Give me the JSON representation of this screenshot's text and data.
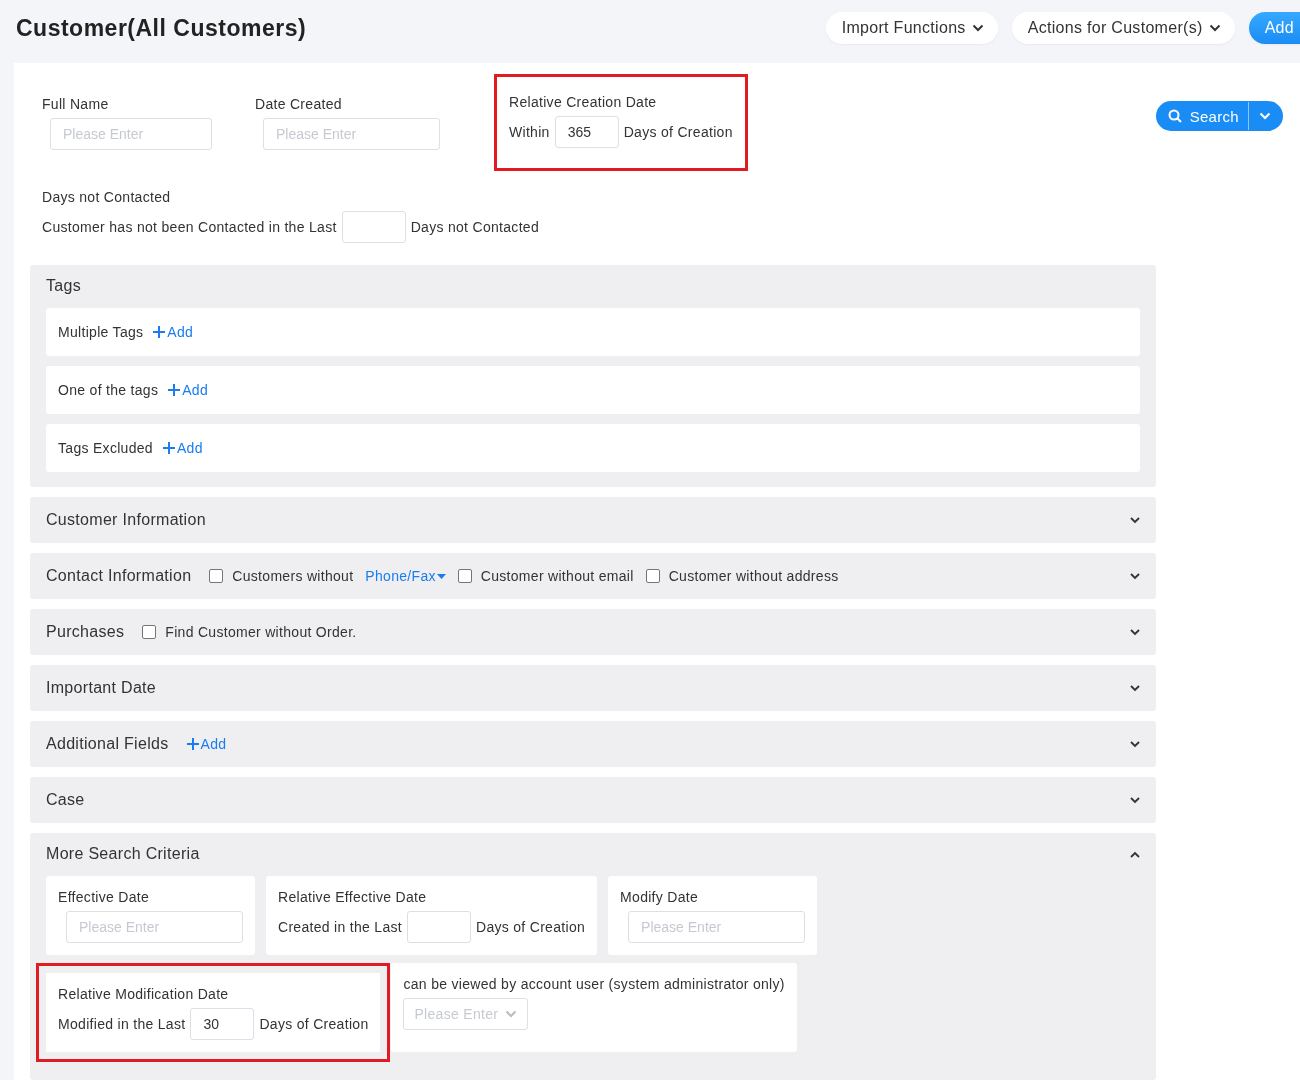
{
  "title": "Customer(All Customers)",
  "header_buttons": [
    {
      "label": "Import Functions",
      "kind": "dropdown"
    },
    {
      "label": "Actions for Customer(s)",
      "kind": "dropdown"
    },
    {
      "label": "Add",
      "kind": "primary"
    }
  ],
  "search_button": {
    "label": "Search"
  },
  "top_fields": [
    {
      "kind": "input",
      "label": "Full Name",
      "placeholder": "Please Enter",
      "highlighted": false
    },
    {
      "kind": "input",
      "label": "Date Created",
      "placeholder": "Please Enter",
      "highlighted": false
    },
    {
      "kind": "relative",
      "label": "Relative Creation Date",
      "prefix": "Within",
      "value": "365",
      "suffix": "Days of Creation",
      "highlighted": true
    }
  ],
  "days_not_contacted": {
    "label": "Days not Contacted",
    "prefix": "Customer has not been Contacted in the Last",
    "suffix": "Days not Contacted"
  },
  "tags": {
    "title": "Tags",
    "rows": [
      {
        "label": "Multiple Tags",
        "action": "Add"
      },
      {
        "label": "One of the tags",
        "action": "Add"
      },
      {
        "label": "Tags Excluded",
        "action": "Add"
      }
    ]
  },
  "sections": [
    {
      "title": "Customer Information",
      "expanded": false
    },
    {
      "title": "Contact Information",
      "expanded": false,
      "extras": [
        {
          "kind": "checkbox",
          "label": "Customers without",
          "checked": false
        },
        {
          "kind": "link",
          "label": "Phone/Fax"
        },
        {
          "kind": "checkbox",
          "label": "Customer without email",
          "checked": false
        },
        {
          "kind": "checkbox",
          "label": "Customer without address",
          "checked": false
        }
      ]
    },
    {
      "title": "Purchases",
      "expanded": false,
      "extras": [
        {
          "kind": "checkbox",
          "label": "Find Customer without Order.",
          "checked": false
        }
      ]
    },
    {
      "title": "Important Date",
      "expanded": false
    },
    {
      "title": "Additional Fields",
      "expanded": false,
      "extras": [
        {
          "kind": "add",
          "label": "Add"
        }
      ]
    },
    {
      "title": "Case",
      "expanded": false
    }
  ],
  "more_criteria": {
    "title": "More Search Criteria",
    "expanded": true,
    "rows": [
      [
        {
          "kind": "input",
          "label": "Effective Date",
          "placeholder": "Please Enter",
          "highlighted": false
        },
        {
          "kind": "relative",
          "label": "Relative Effective Date",
          "prefix": "Created in the Last",
          "suffix": "Days of Creation",
          "highlighted": false
        },
        {
          "kind": "input",
          "label": "Modify Date",
          "placeholder": "Please Enter",
          "highlighted": false
        }
      ],
      [
        {
          "kind": "relative",
          "label": "Relative Modification Date",
          "prefix": "Modified in the Last",
          "value": "30",
          "suffix": "Days of Creation",
          "highlighted": true
        },
        {
          "kind": "select",
          "label": "can be viewed by account user (system administrator only)",
          "placeholder": "Please Enter",
          "highlighted": false
        }
      ]
    ]
  }
}
